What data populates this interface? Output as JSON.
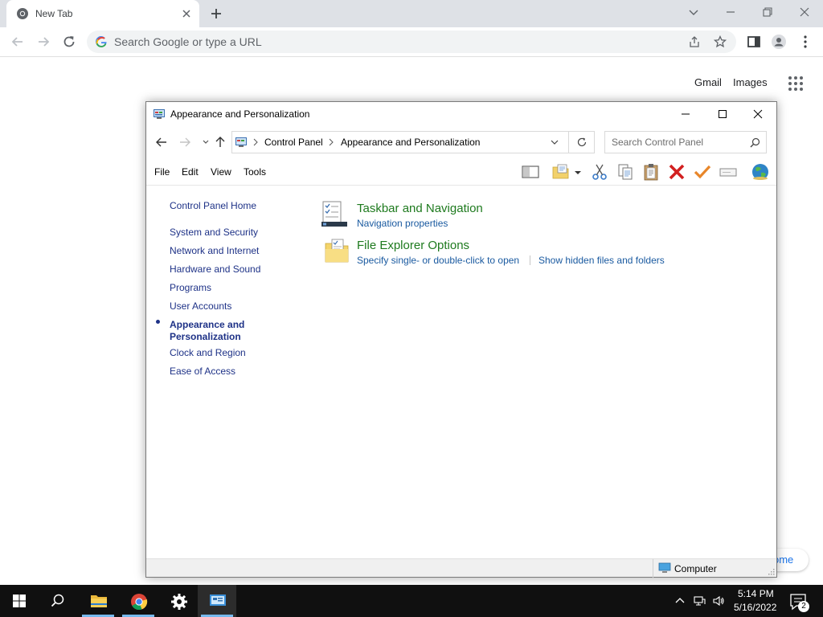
{
  "browser": {
    "tab_title": "New Tab",
    "omnibox_placeholder": "Search Google or type a URL",
    "ntp_links": {
      "gmail": "Gmail",
      "images": "Images"
    },
    "customize_fragment": "ome"
  },
  "window": {
    "title": "Appearance and Personalization",
    "breadcrumb": [
      "Control Panel",
      "Appearance and Personalization"
    ],
    "search_placeholder": "Search Control Panel",
    "menu": [
      "File",
      "Edit",
      "View",
      "Tools"
    ],
    "sidebar": {
      "home": "Control Panel Home",
      "items": [
        "System and Security",
        "Network and Internet",
        "Hardware and Sound",
        "Programs",
        "User Accounts"
      ],
      "current_line1": "Appearance and",
      "current_line2": "Personalization",
      "items_after": [
        "Clock and Region",
        "Ease of Access"
      ]
    },
    "tasks": [
      {
        "title": "Taskbar and Navigation",
        "links": [
          "Navigation properties"
        ]
      },
      {
        "title": "File Explorer Options",
        "links": [
          "Specify single- or double-click to open",
          "Show hidden files and folders"
        ]
      }
    ],
    "status": "Computer"
  },
  "taskbar": {
    "time": "5:14 PM",
    "date": "5/16/2022",
    "notification_count": "2"
  },
  "colors": {
    "task_title": "#1e7a1e",
    "link": "#1a5aa0",
    "sidebar_link": "#1e3287",
    "taskbar_bg": "#101010",
    "active_underline": "#76b9ed"
  }
}
